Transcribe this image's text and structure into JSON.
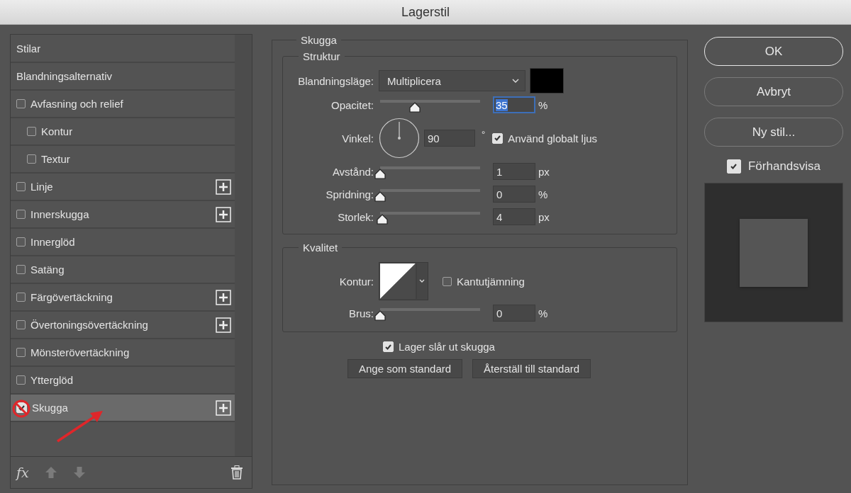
{
  "window": {
    "title": "Lagerstil"
  },
  "sidebar": {
    "items": [
      {
        "label": "Stilar",
        "kind": "header",
        "selected": false,
        "has_add": false
      },
      {
        "label": "Blandningsalternativ",
        "kind": "header",
        "selected": false,
        "has_add": false
      },
      {
        "label": "Avfasning och relief",
        "kind": "checkbox",
        "checked": false,
        "selected": false,
        "has_add": false,
        "children": [
          {
            "label": "Kontur",
            "kind": "checkbox",
            "checked": false,
            "selected": false,
            "has_add": false
          },
          {
            "label": "Textur",
            "kind": "checkbox",
            "checked": false,
            "selected": false,
            "has_add": false
          }
        ]
      },
      {
        "label": "Linje",
        "kind": "checkbox",
        "checked": false,
        "selected": false,
        "has_add": true
      },
      {
        "label": "Innerskugga",
        "kind": "checkbox",
        "checked": false,
        "selected": false,
        "has_add": true
      },
      {
        "label": "Innerglöd",
        "kind": "checkbox",
        "checked": false,
        "selected": false,
        "has_add": false
      },
      {
        "label": "Satäng",
        "kind": "checkbox",
        "checked": false,
        "selected": false,
        "has_add": false
      },
      {
        "label": "Färgövertäckning",
        "kind": "checkbox",
        "checked": false,
        "selected": false,
        "has_add": true
      },
      {
        "label": "Övertoningsövertäckning",
        "kind": "checkbox",
        "checked": false,
        "selected": false,
        "has_add": true
      },
      {
        "label": "Mönsterövertäckning",
        "kind": "checkbox",
        "checked": false,
        "selected": false,
        "has_add": false
      },
      {
        "label": "Ytterglöd",
        "kind": "checkbox",
        "checked": false,
        "selected": false,
        "has_add": false
      },
      {
        "label": "Skugga",
        "kind": "checkbox",
        "checked": true,
        "selected": true,
        "has_add": true
      }
    ],
    "toolbar": {
      "fx_label": "fx"
    }
  },
  "panel": {
    "title": "Skugga",
    "structure": {
      "title": "Struktur",
      "rows": [
        {
          "kind": "select",
          "label": "Blandningsläge:",
          "value": "Multiplicera",
          "color": "#000000"
        },
        {
          "kind": "slider",
          "label": "Opacitet:",
          "level": 0.35,
          "value": "35",
          "unit": "%",
          "focused": true
        },
        {
          "kind": "angle",
          "label": "Vinkel:",
          "value": "90",
          "unit": "°",
          "option": {
            "label": "Använd globalt ljus",
            "checked": true
          }
        },
        {
          "kind": "slider",
          "label": "Avstånd:",
          "level": 0,
          "value": "1",
          "unit": "px",
          "focused": false
        },
        {
          "kind": "slider",
          "label": "Spridning:",
          "level": 0,
          "value": "0",
          "unit": "%",
          "focused": false
        },
        {
          "kind": "slider",
          "label": "Storlek:",
          "level": 0.02,
          "value": "4",
          "unit": "px",
          "focused": false
        }
      ]
    },
    "quality": {
      "title": "Kvalitet",
      "contour": {
        "label": "Kontur:",
        "option": {
          "label": "Kantutjämning",
          "checked": false
        }
      },
      "noise": {
        "label": "Brus:",
        "level": 0,
        "value": "0",
        "unit": "%"
      }
    },
    "knockout": {
      "label": "Lager slår ut skugga",
      "checked": true
    },
    "buttons": [
      "Ange som standard",
      "Återställ till standard"
    ]
  },
  "actions": [
    {
      "label": "OK",
      "default": true
    },
    {
      "label": "Avbryt",
      "default": false
    },
    {
      "label": "Ny stil...",
      "default": false
    }
  ],
  "preview": {
    "label": "Förhandsvisa",
    "checked": true
  }
}
